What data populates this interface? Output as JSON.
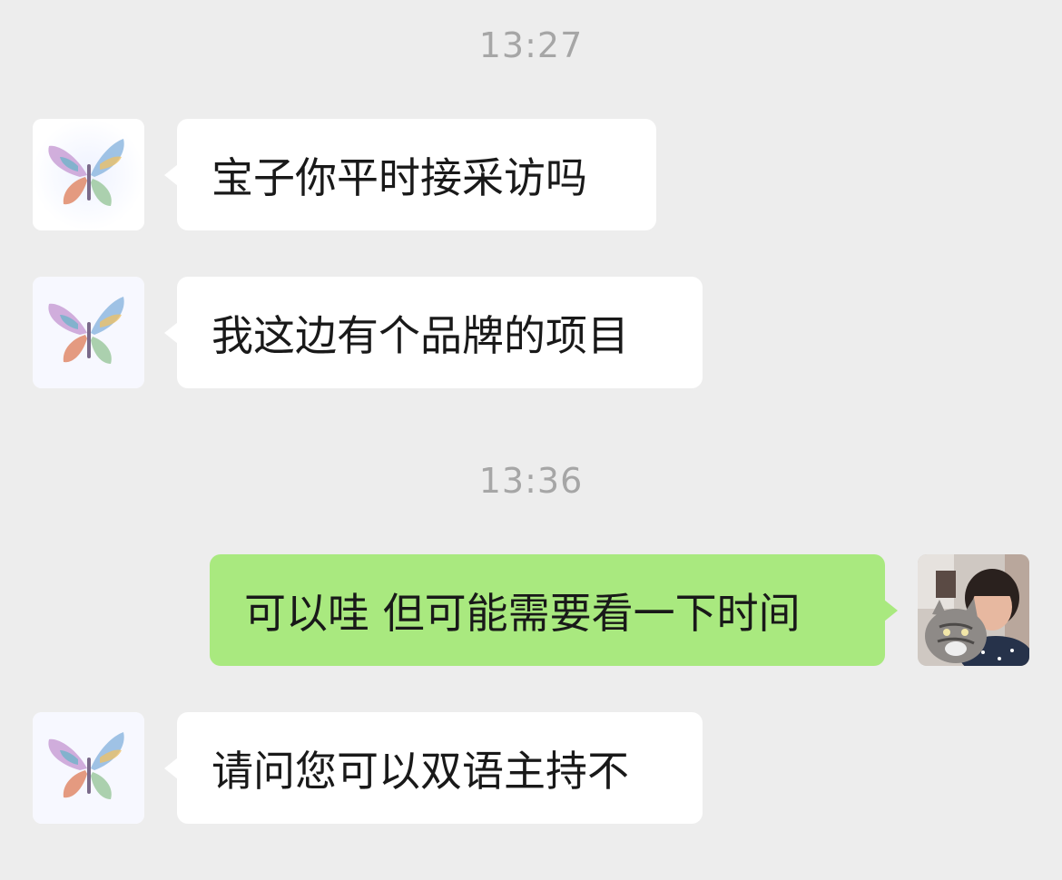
{
  "chat": {
    "timestamps": [
      "13:27",
      "13:36"
    ],
    "messages": [
      {
        "sender": "contact",
        "avatar": "butterfly-avatar",
        "text": "宝子你平时接采访吗"
      },
      {
        "sender": "contact",
        "avatar": "butterfly-avatar",
        "text": "我这边有个品牌的项目"
      },
      {
        "sender": "me",
        "avatar": "user-cat-photo-avatar",
        "text": "可以哇 但可能需要看一下时间"
      },
      {
        "sender": "contact",
        "avatar": "butterfly-avatar",
        "text": "请问您可以双语主持不"
      }
    ]
  },
  "colors": {
    "background": "#ededed",
    "incoming_bubble": "#ffffff",
    "outgoing_bubble": "#a9e97f",
    "timestamp_text": "#a6a6a6",
    "message_text": "#191919"
  }
}
